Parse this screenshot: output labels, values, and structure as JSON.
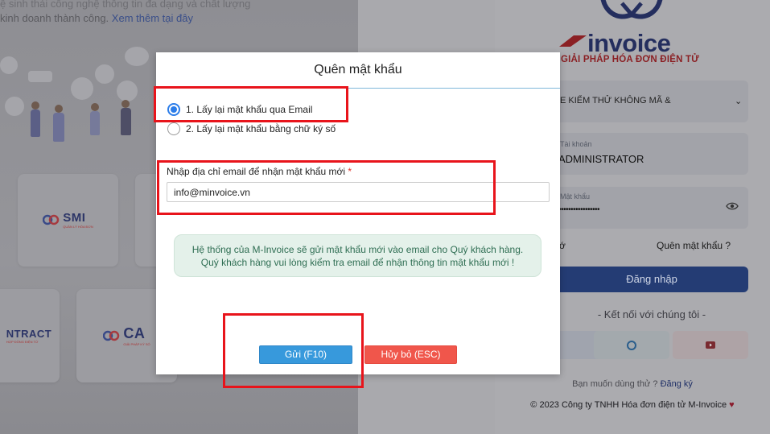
{
  "background": {
    "intro_line1": "ệ sinh thái công nghệ thông tin đa dạng và chất lượng",
    "intro_line2": "kinh doanh thành công.",
    "intro_link": "Xem thêm tại đây",
    "partner_logos": [
      {
        "name": "SMI",
        "sub": "QUẢN LÝ HÓA ĐƠN"
      },
      {
        "name": "NTRACT",
        "sub": "HỢP ĐỒNG ĐIỆN TỬ"
      },
      {
        "name": "CA",
        "sub": "GIẢI PHÁP KÝ SỐ"
      }
    ]
  },
  "login_panel": {
    "brand_name": "invoice",
    "brand_tagline": "GIẢI PHÁP HÓA ĐƠN ĐIỆN TỬ",
    "company_select": "E KIỂM THỬ KHÔNG MÃ &",
    "account_label": "Tài khoản",
    "account_value": "ADMINISTRATOR",
    "password_label": "Mật khẩu",
    "password_value": "•••••••••••••••••",
    "remember_partial": "ớ",
    "forgot_password": "Quên mật khẩu ?",
    "login_button": "Đăng nhập",
    "connect_title": "- Kết nối với chúng tôi -",
    "trial_text": "Bạn muốn dùng thử ?",
    "register_link": "Đăng ký",
    "copyright": "© 2023 Công ty TNHH Hóa đơn điện tử M-Invoice"
  },
  "modal": {
    "title": "Quên mật khẩu",
    "options": [
      {
        "label": "1. Lấy lại mật khẩu qua Email",
        "checked": true
      },
      {
        "label": "2. Lấy lại mật khẩu bằng chữ ký số",
        "checked": false
      }
    ],
    "email_label": "Nhập địa chỉ email để nhận mật khẩu mới",
    "required_mark": "*",
    "email_value": "info@minvoice.vn",
    "info_line1": "Hệ thống của M-Invoice sẽ gửi mật khẩu mới vào email cho Quý khách hàng.",
    "info_line2": "Quý khách hàng vui lòng kiểm tra email để nhận thông tin mật khẩu mới !",
    "send_button": "Gửi (F10)",
    "cancel_button": "Hủy bỏ (ESC)"
  },
  "colors": {
    "primary": "#3799dc",
    "danger": "#f0564b",
    "radio_checked": "#2b7de9",
    "highlight": "#e8141b",
    "info_bg": "#e4f1ea",
    "brand_navy": "#242e5e",
    "brand_red": "#8b2024"
  }
}
